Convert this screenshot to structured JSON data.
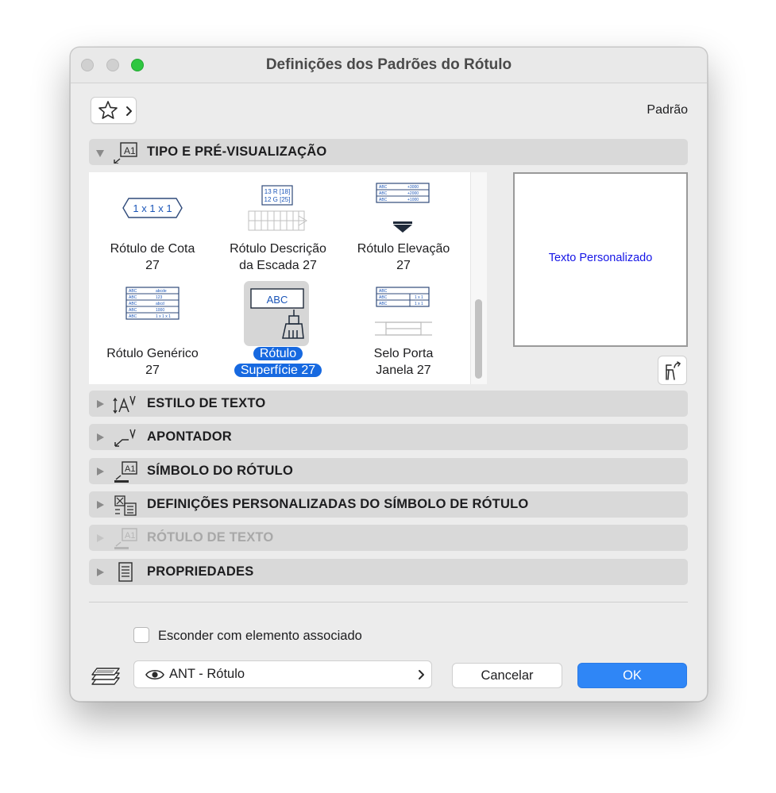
{
  "window": {
    "title": "Definições dos Padrões do Rótulo"
  },
  "header": {
    "favorites_icon": "star-icon",
    "preset_label": "Padrão"
  },
  "sections": [
    {
      "label": "TIPO E PRÉ-VISUALIZAÇÃO",
      "expanded": true,
      "enabled": true
    },
    {
      "label": "ESTILO DE TEXTO",
      "expanded": false,
      "enabled": true
    },
    {
      "label": "APONTADOR",
      "expanded": false,
      "enabled": true
    },
    {
      "label": "SÍMBOLO DO RÓTULO",
      "expanded": false,
      "enabled": true
    },
    {
      "label": "DEFINIÇÕES PERSONALIZADAS DO SÍMBOLO DE RÓTULO",
      "expanded": false,
      "enabled": true
    },
    {
      "label": "RÓTULO DE TEXTO",
      "expanded": false,
      "enabled": false
    },
    {
      "label": "PROPRIEDADES",
      "expanded": false,
      "enabled": true
    }
  ],
  "label_types": [
    {
      "line1": "Rótulo de Cota",
      "line2": "27",
      "thumb_text": "1 x 1 x 1"
    },
    {
      "line1": "Rótulo Descrição",
      "line2": "da Escada 27",
      "thumb_text1": "13 R [18]",
      "thumb_text2": "12 G [25]"
    },
    {
      "line1": "Rótulo Elevação",
      "line2": "27"
    },
    {
      "line1": "Rótulo Genérico",
      "line2": "27"
    },
    {
      "line1": "Rótulo",
      "line2": "Superfície 27",
      "thumb_text": "ABC",
      "selected": true
    },
    {
      "line1": "Selo Porta",
      "line2": "Janela 27"
    }
  ],
  "preview": {
    "text": "Texto Personalizado",
    "color": "#1515e6"
  },
  "options": {
    "hide_with_element_label": "Esconder com elemento associado",
    "hide_with_element_checked": false
  },
  "layer": {
    "value": "ANT - Rótulo",
    "icon": "eye-icon"
  },
  "buttons": {
    "cancel": "Cancelar",
    "ok": "OK"
  },
  "colors": {
    "accent": "#2f86f6",
    "selection": "#1769e0"
  }
}
